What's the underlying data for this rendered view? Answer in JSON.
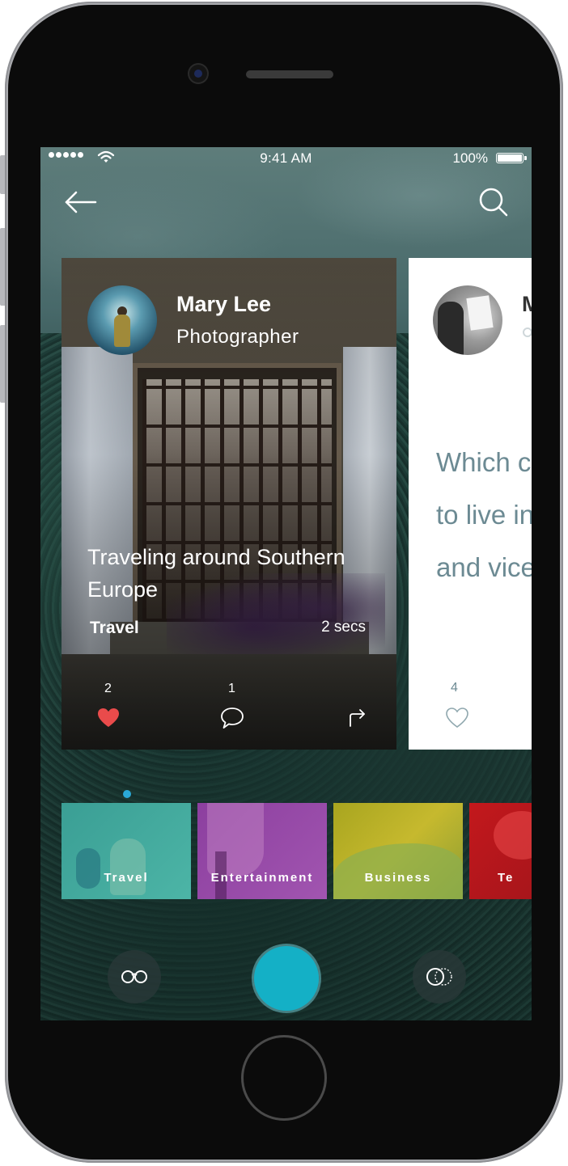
{
  "status_bar": {
    "time": "9:41 AM",
    "battery_percent": "100%",
    "signal_bars": 5
  },
  "nav": {
    "back_icon": "arrow-left-icon",
    "search_icon": "search-icon"
  },
  "cards": [
    {
      "author": "Mary Lee",
      "role": "Photographer",
      "headline": "Traveling around Southern Europe",
      "category": "Travel",
      "age": "2 secs",
      "likes": "2",
      "comments": "1",
      "liked": true
    },
    {
      "author": "M",
      "question": "Which c\nto live in\nand vice",
      "likes": "4",
      "liked": false
    }
  ],
  "categories": [
    {
      "label": "Travel"
    },
    {
      "label": "Entertainment"
    },
    {
      "label": "Business"
    },
    {
      "label": "Te"
    }
  ],
  "controls": {
    "left": "glasses-icon",
    "center": "record-button",
    "right": "blend-circles-icon"
  },
  "colors": {
    "accent": "#14b0c6",
    "heart": "#e94b4b",
    "pager": "#2aa9d8",
    "question_text": "#6c8a93"
  }
}
